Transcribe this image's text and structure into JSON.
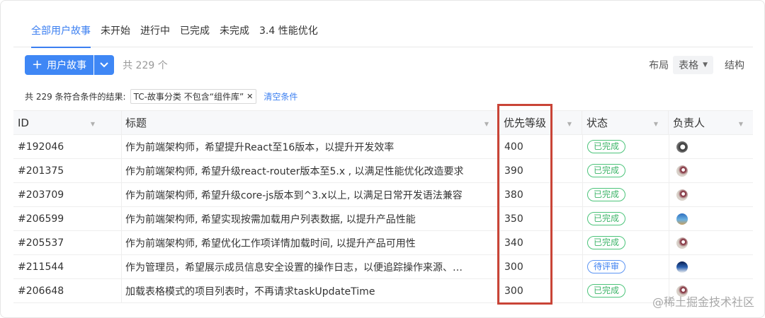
{
  "tabs": [
    {
      "label": "全部用户故事",
      "active": true
    },
    {
      "label": "未开始"
    },
    {
      "label": "进行中"
    },
    {
      "label": "已完成"
    },
    {
      "label": "未完成"
    },
    {
      "label": "3.4 性能优化"
    }
  ],
  "toolbar": {
    "add_label": "用户故事",
    "add_icon": "plus-icon",
    "split_icon": "chevron-down-icon",
    "total": "共 229 个",
    "layout_label": "布局",
    "layout_value": "表格",
    "structure_label": "结构"
  },
  "filter": {
    "summary": "共 229 条符合条件的结果:",
    "chip": "TC-故事分类 不包含“组件库”",
    "clear": "清空条件"
  },
  "table": {
    "headers": {
      "id": "ID",
      "title": "标题",
      "priority": "优先等级",
      "status": "状态",
      "owner": "负责人"
    },
    "rows": [
      {
        "id": "#192046",
        "title": "作为前端架构师，希望提升React至16版本，以提升开发效率",
        "priority": "400",
        "status": "已完成",
        "avatar": "avatar-a"
      },
      {
        "id": "#201375",
        "title": "作为前端架构师, 希望升级react-router版本至5.x , 以满足性能优化改造要求",
        "priority": "390",
        "status": "已完成",
        "avatar": "avatar-b"
      },
      {
        "id": "#203709",
        "title": "作为前端架构师, 希望升级core-js版本到^3.x以上, 以满足日常开发语法兼容",
        "priority": "380",
        "status": "已完成",
        "avatar": "avatar-b"
      },
      {
        "id": "#206599",
        "title": "作为前端架构师, 希望实现按需加载用户列表数据, 以提升产品性能",
        "priority": "350",
        "status": "已完成",
        "avatar": "avatar-c"
      },
      {
        "id": "#205537",
        "title": "作为前端架构师, 希望优化工作项详情加载时间, 以提升产品可用性",
        "priority": "340",
        "status": "已完成",
        "avatar": "avatar-b"
      },
      {
        "id": "#211544",
        "title": "作为管理员，希望展示成员信息安全设置的操作日志，以便追踪操作来源、…",
        "priority": "300",
        "status": "待评审",
        "avatar": "avatar-d"
      },
      {
        "id": "#206648",
        "title": "加载表格模式的项目列表时，不再请求taskUpdateTime",
        "priority": "300",
        "status": "已完成",
        "avatar": "avatar-b"
      }
    ]
  },
  "watermark": "@稀土掘金技术社区",
  "colors": {
    "accent": "#3b7ff1",
    "done": "#3fb56a",
    "review": "#3b7ff1",
    "highlight": "#c94437"
  }
}
